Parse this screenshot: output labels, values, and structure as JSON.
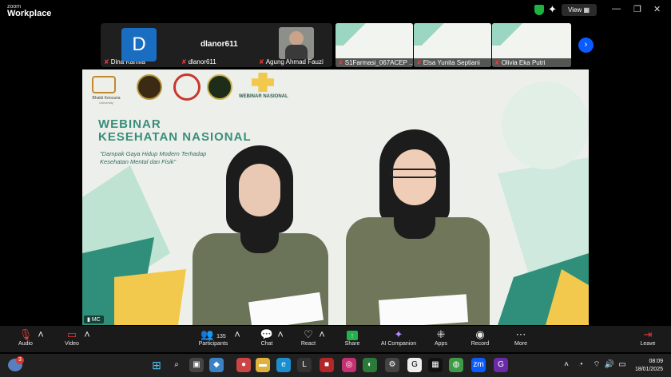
{
  "app": {
    "brand_top": "zoom",
    "brand_bottom": "Workplace",
    "view_label": "View"
  },
  "participants_strip": [
    {
      "name": "Dina Kamila",
      "avatar_letter": "D",
      "muted": true
    },
    {
      "name": "dlanor611",
      "title": "dlanor611",
      "muted": true
    },
    {
      "name": "Agung Ahmad Fauzi",
      "muted": true
    },
    {
      "name": "S1Farmasi_067ACEP ...",
      "muted": true
    },
    {
      "name": "Elsa Yunita Septiani",
      "muted": true
    },
    {
      "name": "Olivia Eka Putri",
      "muted": true
    }
  ],
  "slide": {
    "org_name": "Bhakti Kencana",
    "org_sub": "University",
    "webinar_logo_text": "WEBINAR NASIONAL",
    "title_line1": "WEBINAR",
    "title_line2": "KESEHATAN NASIONAL",
    "subtitle_line1": "\"Dampak Gaya Hidup Modern Terhadap",
    "subtitle_line2": "Kesehatan Mental dan Fisik\""
  },
  "speaker_label": "MC",
  "toolbar": {
    "audio": "Audio",
    "video": "Video",
    "participants": "Participants",
    "participants_count": "135",
    "chat": "Chat",
    "react": "React",
    "share": "Share",
    "ai": "AI Companion",
    "apps": "Apps",
    "record": "Record",
    "more": "More",
    "leave": "Leave"
  },
  "taskbar": {
    "notification_badge": "3",
    "time": "08:09",
    "date": "18/01/2025"
  },
  "colors": {
    "accent_teal": "#3a8d7c",
    "share_green": "#22b14c",
    "leave_red": "#e23b3b",
    "zoom_blue": "#0b5cff"
  }
}
